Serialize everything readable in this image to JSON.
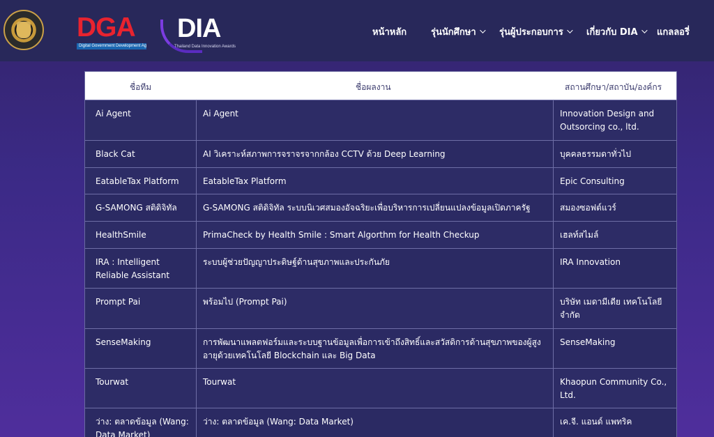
{
  "header": {
    "dga_logo_text": "DGA",
    "dga_tagline": "Digital Government Development Agency",
    "dia_logo_text": "DIA",
    "dia_tagline": "Thailand Data Innovation Awards",
    "nav": [
      {
        "label": "หน้าหลัก",
        "has_dropdown": false
      },
      {
        "label": "รุ่นนักศึกษา",
        "has_dropdown": true
      },
      {
        "label": "รุ่นผู้ประกอบการ",
        "has_dropdown": true
      },
      {
        "label": "เกี่ยวกับ DIA",
        "has_dropdown": true
      },
      {
        "label": "แกลลอรี่",
        "has_dropdown": false
      }
    ]
  },
  "table": {
    "columns": [
      "ชื่อทีม",
      "ชื่อผลงาน",
      "สถานศึกษา/สถาบัน/องค์กร"
    ],
    "rows": [
      {
        "team": "Ai Agent",
        "work": "Ai Agent",
        "org": "Innovation Design and Outsorcing co., ltd."
      },
      {
        "team": "Black Cat",
        "work": "AI วิเคราะห์สภาพการจราจรจากกล้อง CCTV ด้วย Deep Learning",
        "org": "บุคคลธรรมดาทั่วไป"
      },
      {
        "team": "EatableTax Platform",
        "work": "EatableTax Platform",
        "org": "Epic Consulting"
      },
      {
        "team": "G-SAMONG สติดิจิทัล",
        "work": "G-SAMONG สติดิจิทัล ระบบนิเวศสมองอัจฉริยะเพื่อบริหารการเปลี่ยนแปลงข้อมูลเปิดภาครัฐ",
        "org": "สมองซอฟต์แวร์"
      },
      {
        "team": "HealthSmile",
        "work": "PrimaCheck by Health Smile : Smart Algorthm for Health Checkup",
        "org": "เฮลท์สไมล์"
      },
      {
        "team": "IRA : Intelligent Reliable Assistant",
        "work": "ระบบผู้ช่วยปัญญาประดิษฐ์ด้านสุขภาพและประกันภัย",
        "org": "IRA Innovation"
      },
      {
        "team": "Prompt Pai",
        "work": "พร้อมไป (Prompt Pai)",
        "org": "บริษัท เมดามีเดีย เทคโนโลยี จำกัด"
      },
      {
        "team": "SenseMaking",
        "work": "การพัฒนาแพลตฟอร์มและระบบฐานข้อมูลเพื่อการเข้าถึงสิทธิ์และสวัสดิการด้านสุขภาพของผู้สูงอายุด้วยเทคโนโลยี Blockchain และ Big Data",
        "org": "SenseMaking"
      },
      {
        "team": "Tourwat",
        "work": "Tourwat",
        "org": "Khaopun Community Co., Ltd."
      },
      {
        "team": "ว่าง: ตลาดข้อมูล (Wang: Data Market)",
        "work": "ว่าง: ตลาดข้อมูล (Wang: Data Market)",
        "org": "เค.จี. แอนด์ แพทริค"
      }
    ]
  }
}
